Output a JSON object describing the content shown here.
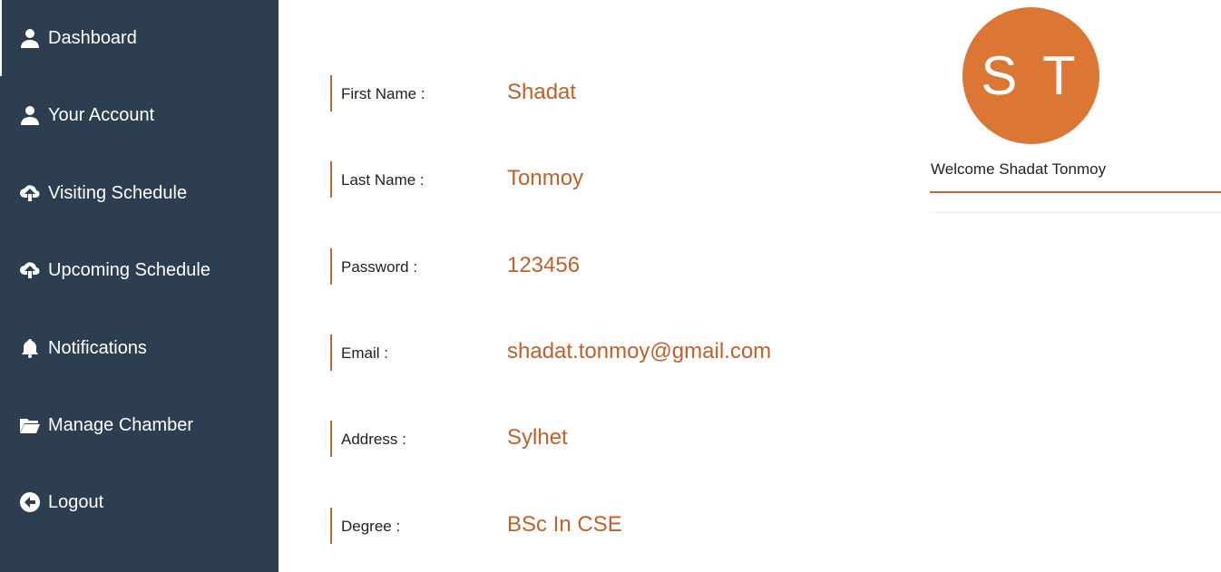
{
  "sidebar": {
    "items": [
      {
        "label": "Dashboard",
        "icon": "user-icon"
      },
      {
        "label": "Your Account",
        "icon": "user-icon"
      },
      {
        "label": "Visiting Schedule",
        "icon": "cloud-upload-icon"
      },
      {
        "label": "Upcoming Schedule",
        "icon": "cloud-upload-icon"
      },
      {
        "label": "Notifications",
        "icon": "bell-icon"
      },
      {
        "label": "Manage Chamber",
        "icon": "folder-open-icon"
      },
      {
        "label": "Logout",
        "icon": "circle-arrow-left-icon"
      }
    ]
  },
  "profile": {
    "fields": [
      {
        "label": "First Name :",
        "value": "Shadat"
      },
      {
        "label": "Last Name :",
        "value": "Tonmoy"
      },
      {
        "label": "Password :",
        "value": "123456"
      },
      {
        "label": "Email :",
        "value": "shadat.tonmoy@gmail.com"
      },
      {
        "label": "Address :",
        "value": "Sylhet"
      },
      {
        "label": "Degree :",
        "value": "BSc In CSE"
      }
    ]
  },
  "user_panel": {
    "initials": "S T",
    "welcome": "Welcome Shadat Tonmoy"
  },
  "colors": {
    "sidebar_bg": "#2d3e50",
    "accent": "#dc7634",
    "value_text": "#c0602a"
  }
}
